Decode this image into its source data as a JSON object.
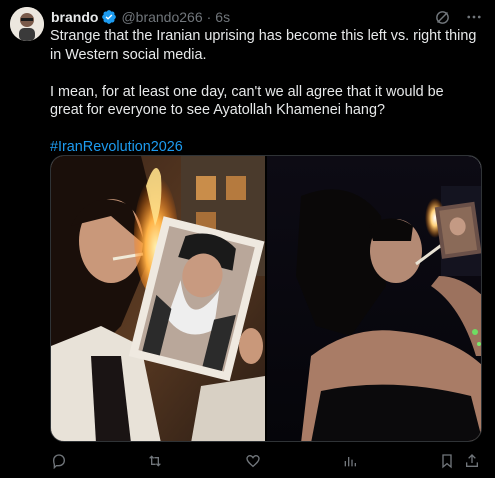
{
  "tweet": {
    "author": {
      "name": "brando",
      "handle": "@brando266",
      "verified": true
    },
    "separator": "·",
    "time": "6s",
    "body": {
      "paragraph1": "Strange that the Iranian uprising has become this left vs. right thing in Western social media.",
      "paragraph2": "I mean, for at least one day, can't we all agree that it would be great for everyone to see Ayatollah Khamenei hang?",
      "hashtag": "#IranRevolution2026"
    },
    "header_icons": [
      "grok-icon",
      "more-icon"
    ],
    "actions": [
      "reply-icon",
      "retweet-icon",
      "like-icon",
      "views-icon",
      "bookmark-icon",
      "share-icon"
    ]
  },
  "colors": {
    "background": "#000000",
    "text": "#e7e9ea",
    "muted": "#71767b",
    "accent": "#1d9bf0"
  },
  "media": {
    "images": [
      {
        "subject": "woman lighting cigarette from burning portrait, daytime"
      },
      {
        "subject": "woman lighting cigarette from burning portrait, night"
      }
    ]
  }
}
